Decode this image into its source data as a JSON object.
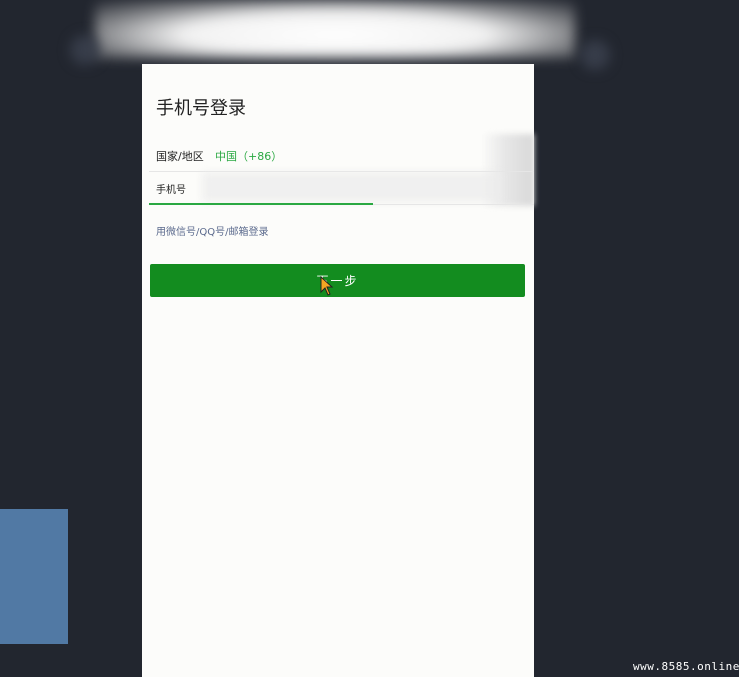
{
  "screen": {
    "title": "手机号登录",
    "country_label": "国家/地区",
    "country_value": "中国（+86）",
    "phone_label": "手机号",
    "alt_login_link": "用微信号/QQ号/邮箱登录",
    "next_button": "下一步"
  },
  "watermark": "www.8585.online",
  "colors": {
    "accent_green": "#2aa842",
    "button_green": "#138c1f",
    "link_blue": "#5b6a8d",
    "background_dark": "#22262f",
    "side_panel_blue": "#5179a4"
  },
  "icons": {
    "cursor": "mouse-pointer-icon"
  }
}
